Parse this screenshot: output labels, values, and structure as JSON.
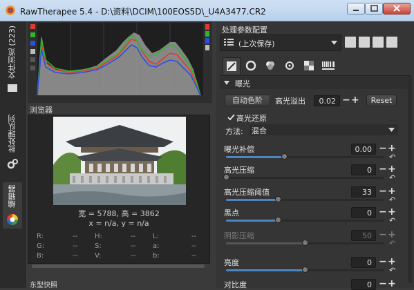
{
  "window": {
    "title": "RawTherapee 5.4 - D:\\资料\\DCIM\\100EOS5D\\_U4A3477.CR2"
  },
  "left_tabs": {
    "file_browser": "文件浏览 (223)",
    "batch_queue": "批处理队列",
    "editor": "编辑器"
  },
  "navigator": {
    "title": "浏览器",
    "dims": "宽 = 5788, 高 = 3862",
    "xy": "x = n/a, y = n/a",
    "info": [
      {
        "k": "R:",
        "v": "--"
      },
      {
        "k": "H:",
        "v": "--"
      },
      {
        "k": "L:",
        "v": "--"
      },
      {
        "k": "G:",
        "v": "--"
      },
      {
        "k": "S:",
        "v": "--"
      },
      {
        "k": "a:",
        "v": "--"
      },
      {
        "k": "B:",
        "v": "--"
      },
      {
        "k": "V:",
        "v": "--"
      },
      {
        "k": "b:",
        "v": "--"
      }
    ],
    "bottom_title": "东型快照"
  },
  "right": {
    "title": "处理参数配置",
    "profile_value": "(上次保存)",
    "exposure": {
      "title": "曝光",
      "auto_levels": "自动色阶",
      "highlight_clip_label": "高光溢出",
      "highlight_clip_value": "0.02",
      "reset": "Reset",
      "highlight_recovery": "高光还原",
      "method_label": "方法:",
      "method_value": "混合",
      "sliders": [
        {
          "label": "曝光补偿",
          "value": "0.00",
          "fraction": 0.37,
          "enabled": true
        },
        {
          "label": "高光压缩",
          "value": "0",
          "fraction": 0.0,
          "enabled": true
        },
        {
          "label": "高光压缩阈值",
          "value": "33",
          "fraction": 0.33,
          "enabled": true
        },
        {
          "label": "黑点",
          "value": "0",
          "fraction": 0.33,
          "enabled": true
        },
        {
          "label": "阴影压缩",
          "value": "50",
          "fraction": 0.5,
          "enabled": false
        },
        {
          "label": "亮度",
          "value": "0",
          "fraction": 0.5,
          "enabled": true
        },
        {
          "label": "对比度",
          "value": "0",
          "fraction": 0.5,
          "enabled": true
        }
      ]
    }
  },
  "colors": {
    "accent": "#4e86c2",
    "panel": "#353535",
    "dark": "#262626"
  }
}
